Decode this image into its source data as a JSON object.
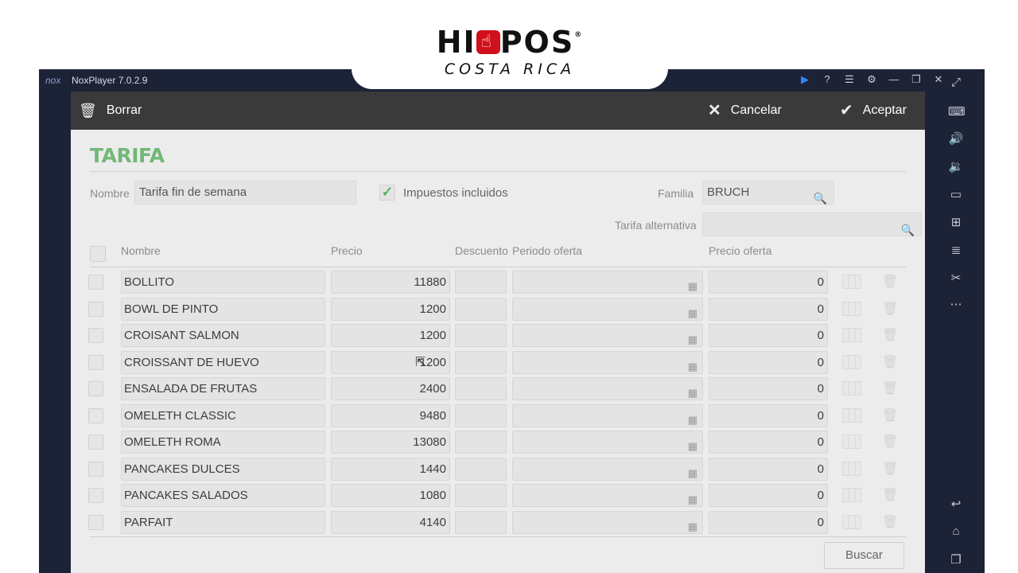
{
  "brand": {
    "name_left": "HI",
    "name_right": "POS",
    "registered": "®",
    "subtitle": "COSTA RICA"
  },
  "window": {
    "logo": "nox",
    "title": "NoxPlayer 7.0.2.9",
    "controls": [
      "play-icon",
      "help-icon",
      "menu-icon",
      "settings-icon",
      "minimize-icon",
      "restore-icon",
      "close-icon"
    ],
    "sidebar": [
      "fullscreen-icon",
      "keyboard-icon",
      "volume-up-icon",
      "volume-down-icon",
      "screen-icon",
      "add-apk-icon",
      "multi-instance-icon",
      "scissors-icon",
      "more-icon",
      "back-icon",
      "home-icon",
      "recent-apps-icon"
    ]
  },
  "toolbar": {
    "delete_label": "Borrar",
    "cancel_label": "Cancelar",
    "accept_label": "Aceptar"
  },
  "form": {
    "title": "TARIFA",
    "name_label": "Nombre",
    "name_value": "Tarifa fin de semana",
    "taxes_included_label": "Impuestos incluidos",
    "taxes_included": true,
    "family_label": "Familia",
    "family_value": "BRUCH",
    "alt_rate_label": "Tarifa alternativa",
    "alt_rate_value": ""
  },
  "table": {
    "columns": [
      "Nombre",
      "Precio",
      "Descuento",
      "Periodo oferta",
      "Precio oferta"
    ],
    "rows": [
      {
        "name": "BOLLITO",
        "price": "11880",
        "discount": "",
        "period": "",
        "offer_price": "0"
      },
      {
        "name": "BOWL DE PINTO",
        "price": "1200",
        "discount": "",
        "period": "",
        "offer_price": "0"
      },
      {
        "name": "CROISANT SALMON",
        "price": "1200",
        "discount": "",
        "period": "",
        "offer_price": "0"
      },
      {
        "name": "CROISSANT DE HUEVO",
        "price": "1200",
        "discount": "",
        "period": "",
        "offer_price": "0"
      },
      {
        "name": "ENSALADA DE FRUTAS",
        "price": "2400",
        "discount": "",
        "period": "",
        "offer_price": "0"
      },
      {
        "name": "OMELETH CLASSIC",
        "price": "9480",
        "discount": "",
        "period": "",
        "offer_price": "0"
      },
      {
        "name": "OMELETH ROMA",
        "price": "13080",
        "discount": "",
        "period": "",
        "offer_price": "0"
      },
      {
        "name": "PANCAKES DULCES",
        "price": "1440",
        "discount": "",
        "period": "",
        "offer_price": "0"
      },
      {
        "name": "PANCAKES SALADOS",
        "price": "1080",
        "discount": "",
        "period": "",
        "offer_price": "0"
      },
      {
        "name": "PARFAIT",
        "price": "4140",
        "discount": "",
        "period": "",
        "offer_price": "0"
      }
    ]
  },
  "search_button_label": "Buscar",
  "colors": {
    "accent_green": "#72b877",
    "toolbar_bg": "#3a3a3a",
    "nox_frame": "#1d2336",
    "brand_red": "#d0101c"
  }
}
